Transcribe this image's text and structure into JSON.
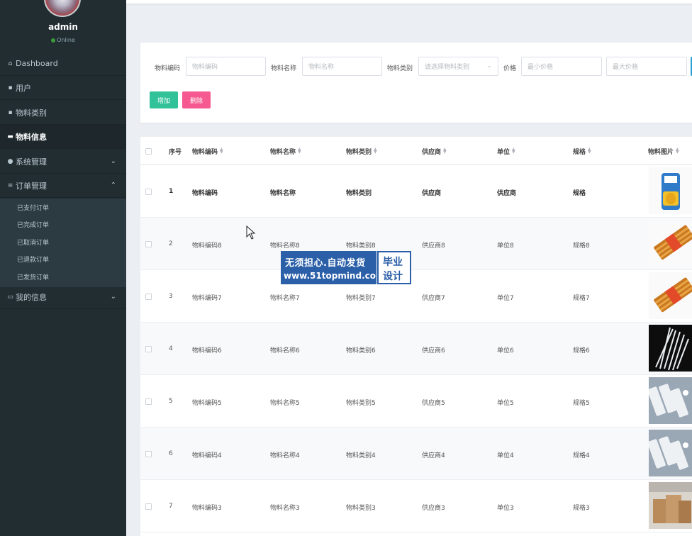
{
  "sidebar": {
    "user": {
      "name": "admin",
      "status": "Online"
    },
    "menu": [
      {
        "label": "Dashboard",
        "icon": "home-icon"
      },
      {
        "label": "用户",
        "icon": "grid-icon"
      },
      {
        "label": "物料类别",
        "icon": "grid-icon"
      },
      {
        "label": "物料信息",
        "icon": "card-icon",
        "active": true
      },
      {
        "label": "系统管理",
        "icon": "user-icon",
        "chevron": "down"
      },
      {
        "label": "订单管理",
        "icon": "list-icon",
        "chevron": "up"
      },
      {
        "label": "我的信息",
        "icon": "id-card-icon",
        "chevron": "down"
      }
    ],
    "order_submenu": [
      "已支付订单",
      "已完成订单",
      "已取消订单",
      "已退款订单",
      "已发货订单"
    ]
  },
  "filters": {
    "code_label": "物料编码",
    "code_placeholder": "物料编码",
    "name_label": "物料名称",
    "name_placeholder": "物料名称",
    "category_label": "物料类别",
    "category_placeholder": "请选择物料类别",
    "price_label": "价格",
    "min_price_placeholder": "最小价格",
    "max_price_placeholder": "最大价格"
  },
  "actions": {
    "add": "增加",
    "delete": "删除"
  },
  "table": {
    "headers": {
      "index": "序号",
      "code": "物料编码",
      "name": "物料名称",
      "category": "物料类别",
      "supplier": "供应商",
      "unit": "单位",
      "spec": "规格",
      "image": "物料图片"
    },
    "rows": [
      {
        "index": "1",
        "code": "物料编码",
        "name": "物料名称",
        "category": "物料类别",
        "supplier": "供应商",
        "unit": "供应商",
        "spec": "规格",
        "image": "rice-bag-image"
      },
      {
        "index": "2",
        "code": "物料编码8",
        "name": "物料名称8",
        "category": "物料类别8",
        "supplier": "供应商8",
        "unit": "单位8",
        "spec": "规格8",
        "image": "chopsticks-pack-image"
      },
      {
        "index": "3",
        "code": "物料编码7",
        "name": "物料名称7",
        "category": "物料类别7",
        "supplier": "供应商7",
        "unit": "单位7",
        "spec": "规格7",
        "image": "chopsticks-pack-image"
      },
      {
        "index": "4",
        "code": "物料编码6",
        "name": "物料名称6",
        "category": "物料类别6",
        "supplier": "供应商6",
        "unit": "单位6",
        "spec": "规格6",
        "image": "straws-image"
      },
      {
        "index": "5",
        "code": "物料编码5",
        "name": "物料名称5",
        "category": "物料类别5",
        "supplier": "供应商5",
        "unit": "单位5",
        "spec": "规格5",
        "image": "cutlery-packs-image"
      },
      {
        "index": "6",
        "code": "物料编码4",
        "name": "物料名称4",
        "category": "物料类别4",
        "supplier": "供应商4",
        "unit": "单位4",
        "spec": "规格4",
        "image": "cutlery-packs-image"
      },
      {
        "index": "7",
        "code": "物料编码3",
        "name": "物料名称3",
        "category": "物料类别3",
        "supplier": "供应商3",
        "unit": "单位3",
        "spec": "规格3",
        "image": "paper-bags-image"
      }
    ]
  },
  "watermark": {
    "line1": "无须担心.自动发货",
    "line2": "www.51topmind.com",
    "right1": "毕业",
    "right2": "设计"
  },
  "colors": {
    "sidebar": "#222d32",
    "add_button": "#32c29a",
    "delete_button": "#f5598f",
    "watermark_blue": "#2b5fa8"
  }
}
